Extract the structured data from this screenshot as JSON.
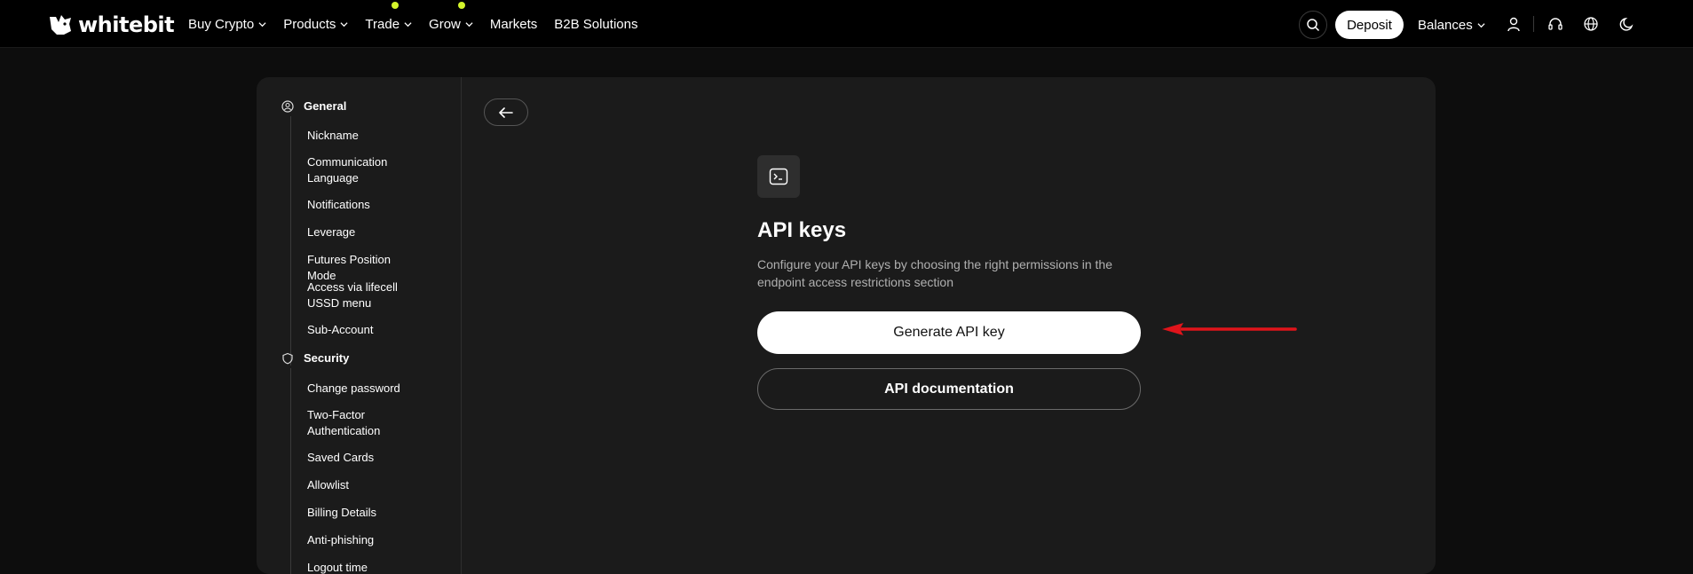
{
  "brand": {
    "logo_text": "whitebit"
  },
  "nav": {
    "items": [
      {
        "label": "Buy Crypto",
        "has_chevron": true,
        "has_dot": false
      },
      {
        "label": "Products",
        "has_chevron": true,
        "has_dot": false
      },
      {
        "label": "Trade",
        "has_chevron": true,
        "has_dot": true
      },
      {
        "label": "Grow",
        "has_chevron": true,
        "has_dot": true
      },
      {
        "label": "Markets",
        "has_chevron": false,
        "has_dot": false
      },
      {
        "label": "B2B Solutions",
        "has_chevron": false,
        "has_dot": false
      }
    ]
  },
  "header": {
    "deposit_label": "Deposit",
    "balances_label": "Balances",
    "icons": [
      "search-icon",
      "user-icon",
      "headset-icon",
      "globe-icon",
      "moon-icon"
    ]
  },
  "sidebar": {
    "general": {
      "label": "General",
      "items": [
        "Nickname",
        "Communication Language",
        "Notifications",
        "Leverage",
        "Futures Position Mode",
        "Access via lifecell USSD menu",
        "Sub-Account"
      ]
    },
    "security": {
      "label": "Security",
      "items": [
        "Change password",
        "Two-Factor Authentication",
        "Saved Cards",
        "Allowlist",
        "Billing Details",
        "Anti-phishing",
        "Logout time"
      ]
    }
  },
  "main": {
    "title": "API keys",
    "description": "Configure your API keys by choosing the right permissions in the endpoint access restrictions section",
    "generate_button": "Generate API key",
    "docs_button": "API documentation"
  },
  "colors": {
    "accent_dot": "#d4f52b",
    "annotation_arrow": "#e0141b",
    "panel_bg": "#1b1b1b",
    "page_bg": "#0d0d0d"
  }
}
